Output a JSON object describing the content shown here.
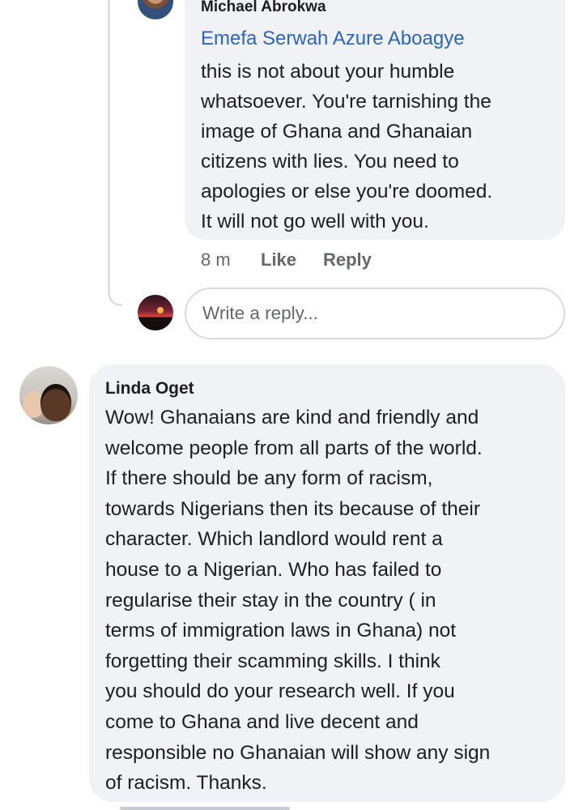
{
  "reply": {
    "author": "Michael Abrokwa",
    "mention": "Emefa Serwah Azure Aboagye",
    "text": "this is not about your humble\nwhatsoever.  You're tarnishing the\nimage of Ghana and Ghanaian\ncitizens with lies. You need to\napologies or else you're doomed.\nIt will not go well with you.",
    "time": "8 m",
    "like_label": "Like",
    "reply_label": "Reply"
  },
  "reply_composer": {
    "placeholder": "Write a reply..."
  },
  "comment": {
    "author": "Linda Oget",
    "text": "Wow!  Ghanaians are kind and friendly and\nwelcome people from all parts of the world.\nIf there should be any form of racism,\ntowards Nigerians then its because of their\ncharacter.  Which landlord would rent a\nhouse to a Nigerian. Who has failed to\nregularise their stay in the country ( in\nterms of immigration laws in Ghana) not\nforgetting their scamming skills.  I think\nyou should do your research well. If you\ncome to Ghana and live decent and\nresponsible no Ghanaian will show any sign\nof racism. Thanks."
  },
  "colors": {
    "bubble_bg": "#f0f2f5",
    "mention_link": "#2d64bc",
    "meta_text": "#65676b",
    "body_text": "#1c1e21"
  }
}
